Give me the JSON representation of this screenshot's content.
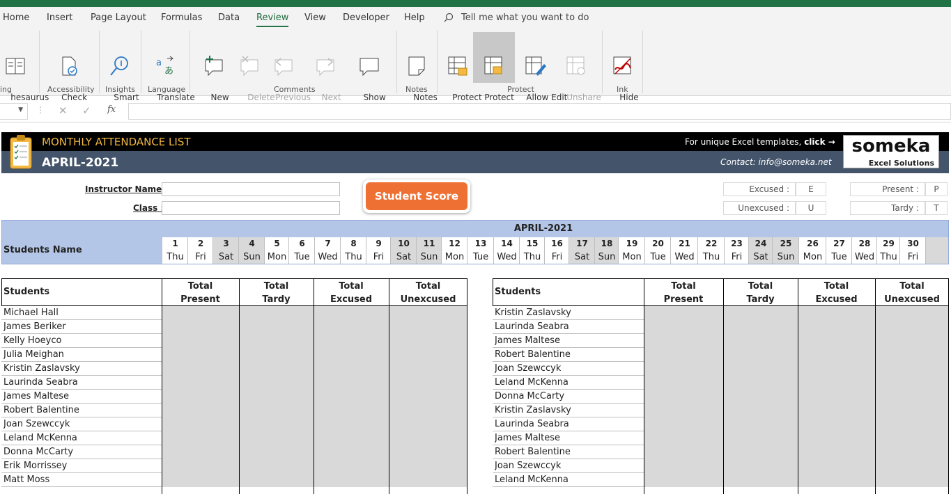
{
  "menu": {
    "tabs": [
      "Home",
      "Insert",
      "Page Layout",
      "Formulas",
      "Data",
      "Review",
      "View",
      "Developer",
      "Help"
    ],
    "active": "Review",
    "tell_me": "Tell me what you want to do"
  },
  "ribbon": {
    "thesaurus": "hesaurus",
    "check_accessibility": "Check\nAccessibility",
    "smart_lookup": "Smart\nLookup",
    "translate": "Translate",
    "new_comment": "New\nComment",
    "delete": "Delete",
    "previous_comment": "Previous\nComment",
    "next_comment": "Next\nComment",
    "show_comments": "Show\nComments",
    "notes": "Notes",
    "protect_sheet": "Protect\nSheet",
    "protect_workbook": "Protect\nWorkbook",
    "allow_edit_ranges": "Allow Edit\nRanges",
    "unshare_workbook": "Unshare\nWorkbook",
    "hide_ink": "Hide\nInk",
    "groups": {
      "proofing": "ing",
      "accessibility": "Accessibility",
      "insights": "Insights",
      "language": "Language",
      "comments": "Comments",
      "notes": "Notes",
      "protect": "Protect",
      "ink": "Ink"
    }
  },
  "formula_bar": {
    "name_box": "",
    "formula": ""
  },
  "sheet": {
    "title": "MONTHLY ATTENDANCE LIST",
    "month": "APRIL-2021",
    "promo": "For unique Excel templates, ",
    "promo_link": "click →",
    "contact": "Contact: info@someka.net",
    "logo": "someka",
    "logo_sub": "Excel Solutions",
    "instructor_label": "Instructor Name :",
    "class_label": "Class :",
    "student_score_button": "Student Score",
    "legend": [
      {
        "label": "Excused :",
        "code": "E"
      },
      {
        "label": "Unexcused :",
        "code": "U"
      },
      {
        "label": "Present :",
        "code": "P"
      },
      {
        "label": "Tardy :",
        "code": "T"
      }
    ],
    "calendar_header": "APRIL-2021",
    "students_name_header": "Students Name",
    "days": [
      [
        "1",
        "Thu"
      ],
      [
        "2",
        "Fri"
      ],
      [
        "3",
        "Sat"
      ],
      [
        "4",
        "Sun"
      ],
      [
        "5",
        "Mon"
      ],
      [
        "6",
        "Tue"
      ],
      [
        "7",
        "Wed"
      ],
      [
        "8",
        "Thu"
      ],
      [
        "9",
        "Fri"
      ],
      [
        "10",
        "Sat"
      ],
      [
        "11",
        "Sun"
      ],
      [
        "12",
        "Mon"
      ],
      [
        "13",
        "Tue"
      ],
      [
        "14",
        "Wed"
      ],
      [
        "15",
        "Thu"
      ],
      [
        "16",
        "Fri"
      ],
      [
        "17",
        "Sat"
      ],
      [
        "18",
        "Sun"
      ],
      [
        "19",
        "Mon"
      ],
      [
        "20",
        "Tue"
      ],
      [
        "21",
        "Wed"
      ],
      [
        "22",
        "Thu"
      ],
      [
        "23",
        "Fri"
      ],
      [
        "24",
        "Sat"
      ],
      [
        "25",
        "Sun"
      ],
      [
        "26",
        "Mon"
      ],
      [
        "27",
        "Tue"
      ],
      [
        "28",
        "Wed"
      ],
      [
        "29",
        "Thu"
      ],
      [
        "30",
        "Fri"
      ]
    ],
    "table_headers": [
      "Students",
      "Total\nPresent",
      "Total\nTardy",
      "Total\nExcused",
      "Total\nUnexcused"
    ],
    "left_students": [
      "Michael Hall",
      "James Beriker",
      "Kelly Hoeyco",
      "Julia Meighan",
      "Kristin Zaslavsky",
      "Laurinda Seabra",
      "James Maltese",
      "Robert Balentine",
      "Joan Szewccyk",
      "Leland McKenna",
      "Donna McCarty",
      "Erik Morrissey",
      "Matt Moss"
    ],
    "right_students": [
      "Kristin Zaslavsky",
      "Laurinda Seabra",
      "James Maltese",
      "Robert Balentine",
      "Joan Szewccyk",
      "Leland McKenna",
      "Donna McCarty",
      "Kristin Zaslavsky",
      "Laurinda Seabra",
      "James Maltese",
      "Robert Balentine",
      "Joan Szewccyk",
      "Leland McKenna"
    ]
  },
  "colors": {
    "excel_green": "#217346",
    "header_dark": "#000000",
    "header_blue": "#44546a",
    "title_orange": "#f4b942",
    "calendar_blue": "#b4c6e7",
    "button_orange": "#ef7033"
  }
}
